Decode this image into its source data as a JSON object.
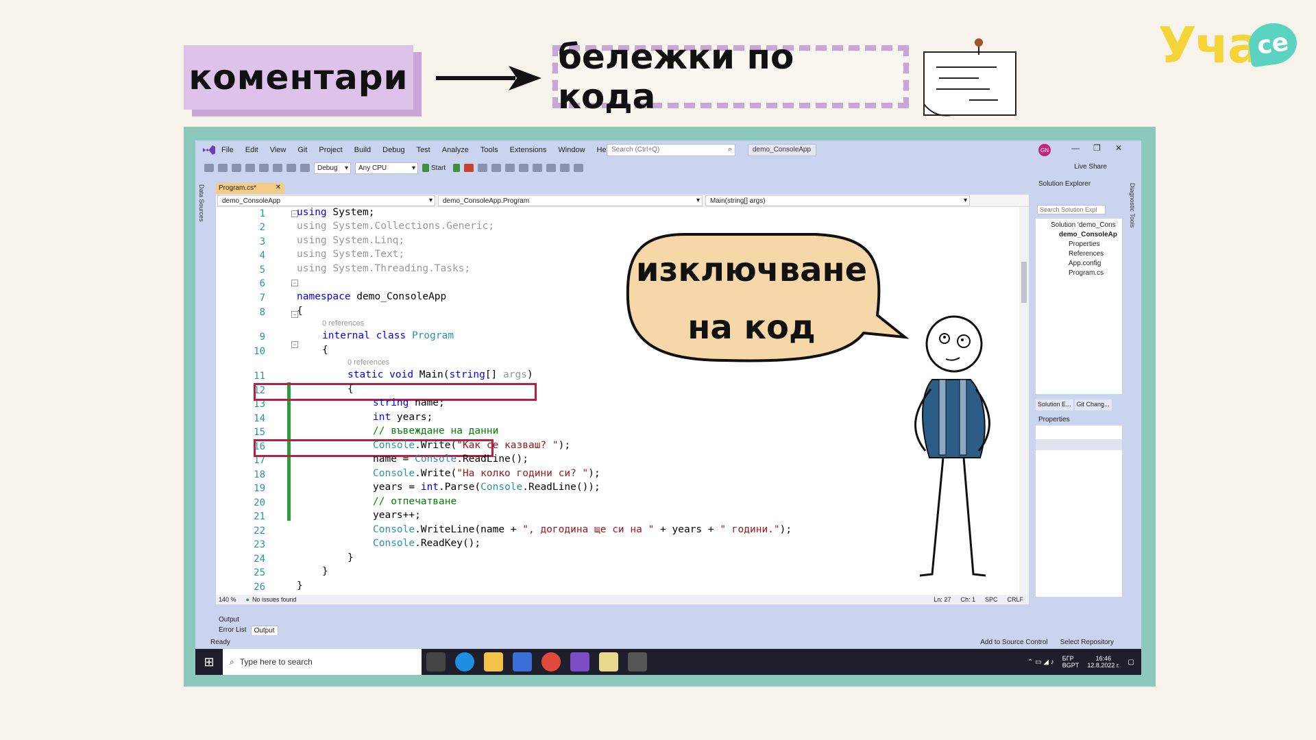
{
  "header": {
    "left_label": "коментари",
    "right_label": "бележки по кода",
    "logo_text": "Уча",
    "logo_badge": "се"
  },
  "bubble": {
    "line1": "изключване",
    "line2": "на код"
  },
  "vs": {
    "menu": [
      "File",
      "Edit",
      "View",
      "Git",
      "Project",
      "Build",
      "Debug",
      "Test",
      "Analyze",
      "Tools",
      "Extensions",
      "Window",
      "Help"
    ],
    "search_placeholder": "Search (Ctrl+Q)",
    "solution_name": "demo_ConsoleApp",
    "avatar": "GN",
    "toolbar": {
      "config": "Debug",
      "platform": "Any CPU",
      "start": "Start",
      "live_share": "Live Share"
    },
    "left_strip": "Data Sources",
    "right_strip": "Diagnostic Tools",
    "tab": "Program.cs*",
    "nav": {
      "project": "demo_ConsoleApp",
      "class": "demo_ConsoleApp.Program",
      "member": "Main(string[] args)"
    },
    "line_numbers": [
      "1",
      "2",
      "3",
      "4",
      "5",
      "6",
      "7",
      "8",
      "9",
      "10",
      "11",
      "12",
      "13",
      "14",
      "15",
      "16",
      "17",
      "18",
      "19",
      "20",
      "21",
      "22",
      "23",
      "24",
      "25",
      "26"
    ],
    "references": "0 references",
    "code": {
      "l1a": "using",
      "l1b": " System;",
      "l2": "using System.Collections.Generic;",
      "l3": "using System.Linq;",
      "l4": "using System.Text;",
      "l5": "using System.Threading.Tasks;",
      "l7a": "namespace",
      "l7b": " demo_ConsoleApp",
      "l8": "{",
      "l9a": "internal",
      "l9b": "class",
      "l9c": "Program",
      "l10": "{",
      "l11a": "static",
      "l11b": "void",
      "l11c": "Main(",
      "l11d": "string",
      "l11e": "[] ",
      "l11f": "args",
      "l11g": ")",
      "l12": "{",
      "l13a": "string",
      "l13b": " name;",
      "l14a": "int",
      "l14b": " years;",
      "l15": "// въвеждане на данни",
      "l16a": "Console",
      "l16b": ".Write(",
      "l16c": "\"Как се казваш? \"",
      "l16d": ");",
      "l17a": "name = ",
      "l17b": "Console",
      "l17c": ".ReadLine();",
      "l18a": "Console",
      "l18b": ".Write(",
      "l18c": "\"На колко години си? \"",
      "l18d": ");",
      "l19a": "years = ",
      "l19b": "int",
      "l19c": ".Parse(",
      "l19d": "Console",
      "l19e": ".ReadLine());",
      "l20": "// отпечатване",
      "l21": "years++;",
      "l22a": "Console",
      "l22b": ".WriteLine(name + ",
      "l22c": "\", догодина ще си на \"",
      "l22d": " + years + ",
      "l22e": "\" години.\"",
      "l22f": ");",
      "l23a": "Console",
      "l23b": ".ReadKey();",
      "l24": "}",
      "l25": "}",
      "l26": "}"
    },
    "editor_status": {
      "zoom": "140 %",
      "issues": "No issues found",
      "ln": "Ln: 27",
      "ch": "Ch: 1",
      "spc": "SPC",
      "crlf": "CRLF"
    },
    "output": {
      "title": "Output",
      "tabs": [
        "Error List",
        "Output"
      ]
    },
    "solution_explorer": {
      "title": "Solution Explorer",
      "search": "Search Solution Expl",
      "items": [
        "Solution 'demo_Cons",
        "demo_ConsoleAp",
        "Properties",
        "References",
        "App.config",
        "Program.cs"
      ],
      "tabs": [
        "Solution E...",
        "Git Chang..."
      ]
    },
    "properties_title": "Properties",
    "status": {
      "ready": "Ready",
      "add_source": "Add to Source Control",
      "select_repo": "Select Repository"
    },
    "taskbar": {
      "search": "Type here to search",
      "lang": "БГР",
      "lang2": "BGPT",
      "time": "16:46",
      "date": "12.8.2022 г."
    }
  }
}
